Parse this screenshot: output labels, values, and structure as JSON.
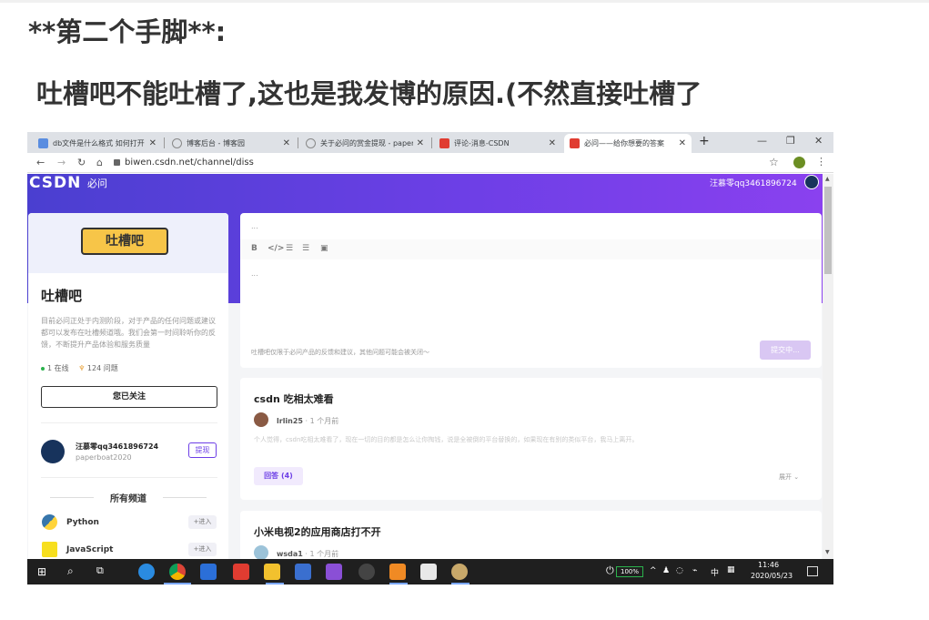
{
  "heading": {
    "line1": "**第二个手脚**:",
    "line2": "吐槽吧不能吐槽了,这也是我发博的原因.(不然直接吐槽了"
  },
  "browser": {
    "tabs": [
      {
        "title": "db文件是什么格式 如何打开",
        "favicon_color": "#5a8de0"
      },
      {
        "title": "博客后台 - 博客园",
        "favicon_color": "#888888"
      },
      {
        "title": "关于必问的赏金提现 - paper",
        "favicon_color": "#888888"
      },
      {
        "title": "评论-消息-CSDN",
        "favicon_color": "#e03c31"
      },
      {
        "title": "必问——给你想要的答案",
        "favicon_color": "#e03c31",
        "active": true
      }
    ],
    "new_tab": "+",
    "url": "biwen.csdn.net/channel/diss"
  },
  "site": {
    "logo": "CSDN",
    "logo_sub": "必问",
    "user_name": "汪慕零qq3461896724",
    "left": {
      "ribbon": "吐槽吧",
      "title": "吐槽吧",
      "description": "目前必问正处于内测阶段，对于产品的任何问题或建议都可以发布在吐槽频道哦。我们会第一时间聆听你的反馈，不断提升产品体验和服务质量",
      "online": "1 在线",
      "questions": "124 问题",
      "follow_label": "您已关注",
      "owner_name": "汪慕零qq3461896724",
      "owner_sub": "paperboat2020",
      "withdraw_label": "提现",
      "channels_title": "所有频道",
      "channels": [
        {
          "name": "Python",
          "action": "+进入"
        },
        {
          "name": "JavaScript",
          "action": "+进入"
        }
      ]
    },
    "editor": {
      "top_placeholder": "...",
      "body_placeholder": "...",
      "note": "吐槽吧仅限于必问产品的反馈和建议，其他问题可能会被关闭～",
      "submit_label": "提交中..."
    },
    "posts": [
      {
        "title": "csdn 吃相太难看",
        "author": "lrlin25",
        "time": "· 1 个月前",
        "excerpt": "个人觉得，csdn吃相太难看了，现在一切的目的都是怎么让你掏钱，说是全被倒的平台替换的，如果现在有别的类似平台，我马上离开。",
        "reply_label": "回答 (4)",
        "expand_label": "展开 ⌄"
      },
      {
        "title": "小米电视2的应用商店打不开",
        "author": "wsda1",
        "time": "· 1 个月前"
      }
    ]
  },
  "taskbar": {
    "battery": "100%",
    "ime": "中",
    "time": "11:46",
    "date": "2020/05/23"
  }
}
